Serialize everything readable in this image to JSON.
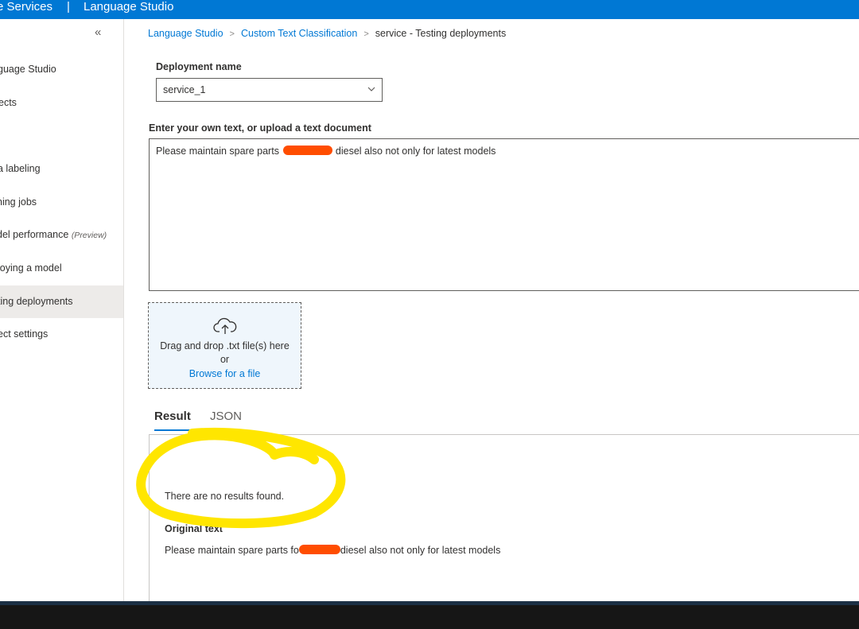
{
  "topbar": {
    "service": "e Services",
    "separator": "|",
    "app": "Language Studio"
  },
  "sidebar": {
    "collapse": "«",
    "items": [
      {
        "label": "guage Studio"
      },
      {
        "label": "ects"
      },
      {
        "label": "a labeling"
      },
      {
        "label": "ning jobs"
      },
      {
        "label": "del performance",
        "tag": "(Preview)"
      },
      {
        "label": "loying a model"
      },
      {
        "label": "ting deployments",
        "active": true
      },
      {
        "label": "ect settings"
      }
    ]
  },
  "breadcrumb": {
    "items": [
      "Language Studio",
      "Custom Text Classification"
    ],
    "current": "service - Testing deployments"
  },
  "deployment": {
    "label": "Deployment name",
    "value": "service_1"
  },
  "input": {
    "label": "Enter your own text, or upload a text document",
    "text_before": "Please maintain spare parts",
    "text_after": "diesel also not only for latest models"
  },
  "dropzone": {
    "line1": "Drag and drop .txt file(s) here",
    "line2": "or",
    "browse": "Browse for a file"
  },
  "tabs": {
    "result": "Result",
    "json": "JSON"
  },
  "result": {
    "message": "There are no results found.",
    "original_label": "Original text",
    "original_before": "Please maintain spare parts fo",
    "original_after": "diesel also not only for latest models"
  },
  "colors": {
    "accent": "#0078d4",
    "highlight": "#ffe600",
    "redaction": "#ff4d00"
  }
}
